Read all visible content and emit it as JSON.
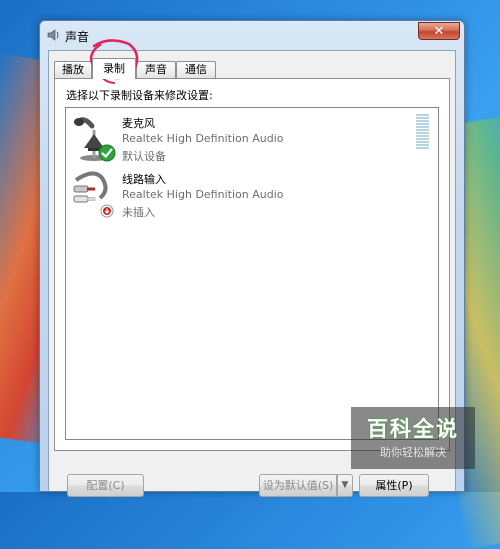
{
  "window": {
    "title": "声音",
    "close_label": "✕"
  },
  "tabs": [
    {
      "label": "播放",
      "active": false
    },
    {
      "label": "录制",
      "active": true
    },
    {
      "label": "声音",
      "active": false
    },
    {
      "label": "通信",
      "active": false
    }
  ],
  "instruction": "选择以下录制设备来修改设置:",
  "devices": [
    {
      "name": "麦克风",
      "driver": "Realtek High Definition Audio",
      "status": "默认设备",
      "icon": "microphone-icon",
      "badge": "default-check-icon"
    },
    {
      "name": "线路输入",
      "driver": "Realtek High Definition Audio",
      "status": "未插入",
      "icon": "line-in-cable-icon",
      "badge": "unplugged-icon"
    }
  ],
  "buttons": {
    "configure": "配置(C)",
    "set_default": "设为默认值(S)",
    "set_default_arrow": "▼",
    "properties_partial": "属性(P)"
  },
  "watermark": {
    "title": "百科全说",
    "subtitle": "助你轻松解决"
  },
  "colors": {
    "accent_annotation": "#e0245e",
    "check_green": "#2fa33b",
    "unplugged_red": "#c8281e"
  }
}
